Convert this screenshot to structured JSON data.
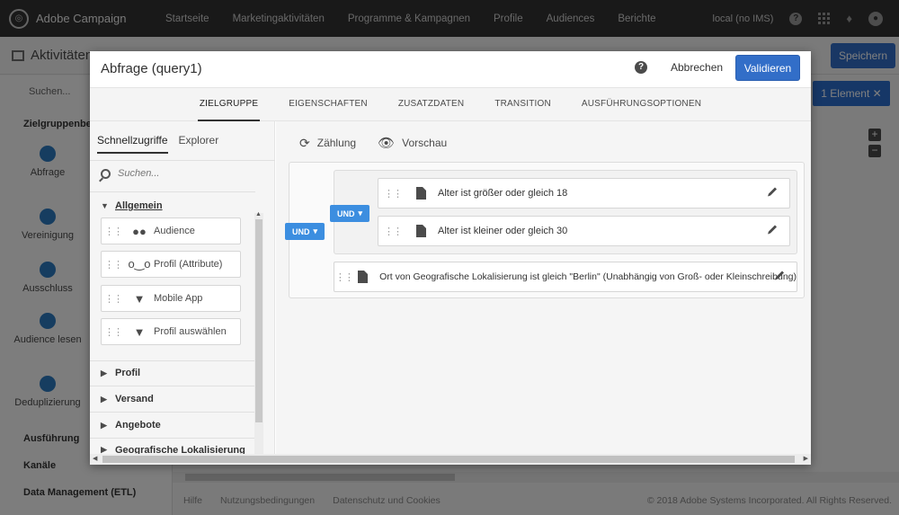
{
  "topbar": {
    "brand": "Adobe Campaign",
    "nav": [
      "Startseite",
      "Marketingaktivitäten",
      "Programme & Kampagnen",
      "Profile",
      "Audiences",
      "Berichte"
    ],
    "instance": "local (no IMS)"
  },
  "background": {
    "page_title": "Aktivitäten",
    "save_label": "Speichern",
    "search_placeholder": "Suchen...",
    "group_title": "Zielgruppenbesti",
    "activities": [
      "Abfrage",
      "Vereinigung",
      "Ausschluss",
      "Audience lesen",
      "Deduplizierung"
    ],
    "groups": [
      "Ausführung",
      "Kanäle",
      "Data Management (ETL)"
    ],
    "element_badge": "1 Element",
    "footer_links": [
      "Hilfe",
      "Nutzungsbedingungen",
      "Datenschutz und Cookies"
    ],
    "copyright": "© 2018 Adobe Systems Incorporated. All Rights Reserved."
  },
  "modal": {
    "title": "Abfrage (query1)",
    "cancel_label": "Abbrechen",
    "validate_label": "Validieren",
    "tabs": [
      "ZIELGRUPPE",
      "EIGENSCHAFTEN",
      "ZUSATZDATEN",
      "TRANSITION",
      "AUSFÜHRUNGSOPTIONEN"
    ],
    "left": {
      "tabs": [
        "Schnellzugriffe",
        "Explorer"
      ],
      "search_placeholder": "Suchen...",
      "section_general": "Allgemein",
      "items": [
        "Audience",
        "Profil (Attribute)",
        "Mobile App",
        "Profil auswählen"
      ],
      "sections": [
        "Profil",
        "Versand",
        "Angebote",
        "Geografische Lokalisierung"
      ]
    },
    "toolbar": {
      "count_label": "Zählung",
      "preview_label": "Vorschau"
    },
    "conditions": {
      "outer_operator": "UND",
      "inner_operator": "UND",
      "c1": "Alter ist größer oder gleich 18",
      "c2": "Alter ist kleiner oder gleich 30",
      "c3": "Ort von Geografische Lokalisierung ist gleich \"Berlin\" (Unabhängig von Groß- oder Kleinschreibung)"
    }
  }
}
